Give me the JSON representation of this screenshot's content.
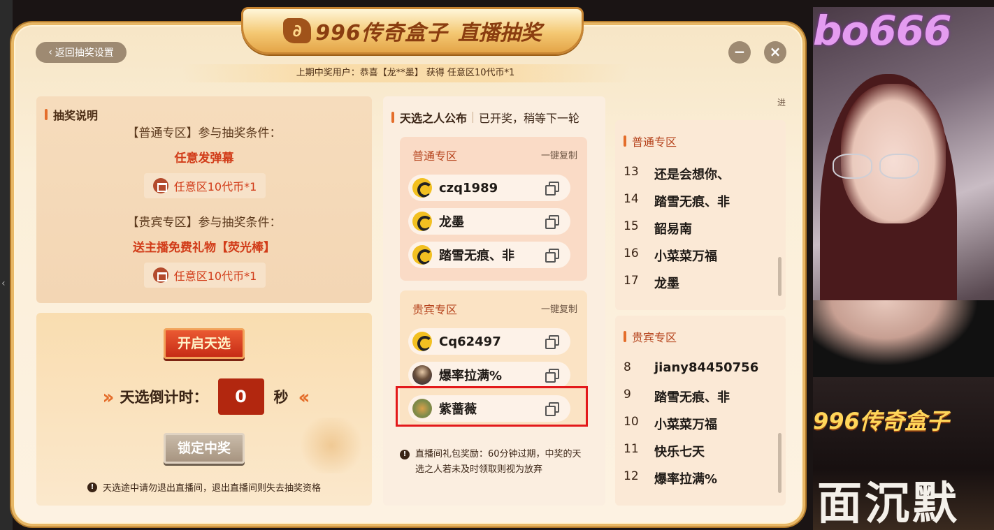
{
  "title": {
    "brand": "996传奇盒子",
    "subtitle": "直播抽奖"
  },
  "back_label": "返回抽奖设置",
  "min_label": "−",
  "close_label": "×",
  "last_winner": "上期中奖用户：恭喜【龙**墨】 获得 任意区10代币*1",
  "rules": {
    "heading": "抽奖说明",
    "normal_cond": "【普通专区】参与抽奖条件：",
    "normal_req": "任意发弹幕",
    "normal_prize": "任意区10代币*1",
    "vip_cond": "【贵宾专区】参与抽奖条件：",
    "vip_req": "送主播免费礼物【荧光棒】",
    "vip_prize": "任意区10代币*1"
  },
  "start": {
    "start_label": "开启天选",
    "countdown_label": "天选倒计时：",
    "countdown_value": "0",
    "countdown_unit": "秒",
    "lock_label": "锁定中奖",
    "warning": "天选途中请勿退出直播间，退出直播间则失去抽奖资格"
  },
  "announce": {
    "heading": "天选之人公布",
    "status": "已开奖，稍等下一轮",
    "copy_all": "一键复制",
    "normal_title": "普通专区",
    "normal_winners": [
      "czq1989",
      "龙墨",
      "踏雪无痕、非"
    ],
    "vip_title": "贵宾专区",
    "vip_winners": [
      "Cq62497",
      "爆率拉满%",
      "紫蔷薇"
    ],
    "notice": "直播间礼包奖励：60分钟过期，中奖的天选之人若未及时领取则视为放弃"
  },
  "ranking": {
    "top_label": "进",
    "normal_title": "普通专区",
    "normal_rows": [
      {
        "num": "13",
        "name": "还是会想你、"
      },
      {
        "num": "14",
        "name": "踏雪无痕、非"
      },
      {
        "num": "15",
        "name": "韶易南"
      },
      {
        "num": "16",
        "name": "小菜菜万福"
      },
      {
        "num": "17",
        "name": "龙墨"
      }
    ],
    "vip_title": "贵宾专区",
    "vip_rows": [
      {
        "num": "8",
        "name": "jiany84450756"
      },
      {
        "num": "9",
        "name": "踏雪无痕、非"
      },
      {
        "num": "10",
        "name": "小菜菜万福"
      },
      {
        "num": "11",
        "name": "快乐七天"
      },
      {
        "num": "12",
        "name": "爆率拉满%"
      }
    ]
  },
  "stream": {
    "handle": "bo666",
    "logo": "996传奇盒子",
    "calligraphy": "面沉默"
  },
  "colors": {
    "accent": "#e46d2a",
    "danger": "#d13b18",
    "highlight": "#e3191b"
  }
}
